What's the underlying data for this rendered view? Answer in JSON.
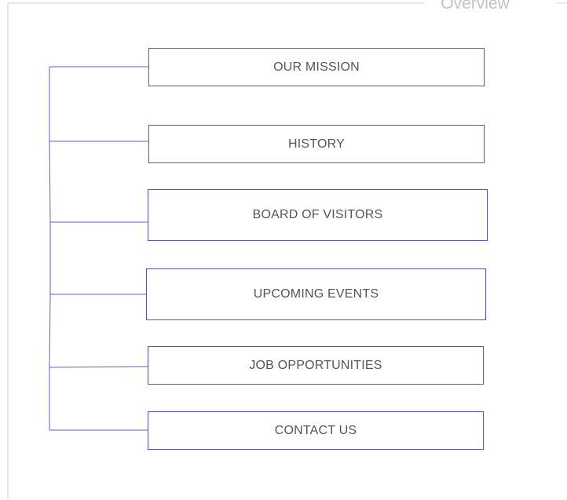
{
  "header": {
    "title": "Overview"
  },
  "nodes": [
    {
      "id": "mission",
      "label": "OUR MISSION"
    },
    {
      "id": "history",
      "label": "HISTORY"
    },
    {
      "id": "board",
      "label": "BOARD OF VISITORS"
    },
    {
      "id": "events",
      "label": "UPCOMING EVENTS"
    },
    {
      "id": "jobs",
      "label": "JOB OPPORTUNITIES"
    },
    {
      "id": "contact",
      "label": "CONTACT US"
    }
  ],
  "colors": {
    "frame": "#d0d0d0",
    "title": "#c3c3c3",
    "node_border": "#5b4fc9",
    "connector": "#6a5acd",
    "node_text": "#555555"
  }
}
